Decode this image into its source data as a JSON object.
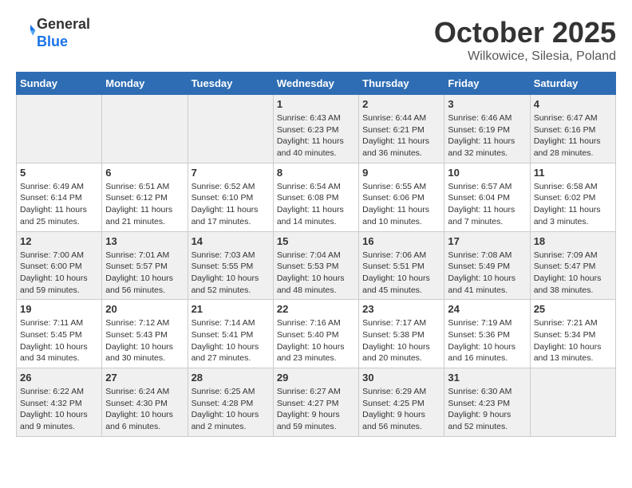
{
  "header": {
    "logo": {
      "general": "General",
      "blue": "Blue"
    },
    "title": "October 2025",
    "location": "Wilkowice, Silesia, Poland"
  },
  "days_of_week": [
    "Sunday",
    "Monday",
    "Tuesday",
    "Wednesday",
    "Thursday",
    "Friday",
    "Saturday"
  ],
  "weeks": [
    [
      {
        "day": "",
        "info": ""
      },
      {
        "day": "",
        "info": ""
      },
      {
        "day": "",
        "info": ""
      },
      {
        "day": "1",
        "info": "Sunrise: 6:43 AM\nSunset: 6:23 PM\nDaylight: 11 hours\nand 40 minutes."
      },
      {
        "day": "2",
        "info": "Sunrise: 6:44 AM\nSunset: 6:21 PM\nDaylight: 11 hours\nand 36 minutes."
      },
      {
        "day": "3",
        "info": "Sunrise: 6:46 AM\nSunset: 6:19 PM\nDaylight: 11 hours\nand 32 minutes."
      },
      {
        "day": "4",
        "info": "Sunrise: 6:47 AM\nSunset: 6:16 PM\nDaylight: 11 hours\nand 28 minutes."
      }
    ],
    [
      {
        "day": "5",
        "info": "Sunrise: 6:49 AM\nSunset: 6:14 PM\nDaylight: 11 hours\nand 25 minutes."
      },
      {
        "day": "6",
        "info": "Sunrise: 6:51 AM\nSunset: 6:12 PM\nDaylight: 11 hours\nand 21 minutes."
      },
      {
        "day": "7",
        "info": "Sunrise: 6:52 AM\nSunset: 6:10 PM\nDaylight: 11 hours\nand 17 minutes."
      },
      {
        "day": "8",
        "info": "Sunrise: 6:54 AM\nSunset: 6:08 PM\nDaylight: 11 hours\nand 14 minutes."
      },
      {
        "day": "9",
        "info": "Sunrise: 6:55 AM\nSunset: 6:06 PM\nDaylight: 11 hours\nand 10 minutes."
      },
      {
        "day": "10",
        "info": "Sunrise: 6:57 AM\nSunset: 6:04 PM\nDaylight: 11 hours\nand 7 minutes."
      },
      {
        "day": "11",
        "info": "Sunrise: 6:58 AM\nSunset: 6:02 PM\nDaylight: 11 hours\nand 3 minutes."
      }
    ],
    [
      {
        "day": "12",
        "info": "Sunrise: 7:00 AM\nSunset: 6:00 PM\nDaylight: 10 hours\nand 59 minutes."
      },
      {
        "day": "13",
        "info": "Sunrise: 7:01 AM\nSunset: 5:57 PM\nDaylight: 10 hours\nand 56 minutes."
      },
      {
        "day": "14",
        "info": "Sunrise: 7:03 AM\nSunset: 5:55 PM\nDaylight: 10 hours\nand 52 minutes."
      },
      {
        "day": "15",
        "info": "Sunrise: 7:04 AM\nSunset: 5:53 PM\nDaylight: 10 hours\nand 48 minutes."
      },
      {
        "day": "16",
        "info": "Sunrise: 7:06 AM\nSunset: 5:51 PM\nDaylight: 10 hours\nand 45 minutes."
      },
      {
        "day": "17",
        "info": "Sunrise: 7:08 AM\nSunset: 5:49 PM\nDaylight: 10 hours\nand 41 minutes."
      },
      {
        "day": "18",
        "info": "Sunrise: 7:09 AM\nSunset: 5:47 PM\nDaylight: 10 hours\nand 38 minutes."
      }
    ],
    [
      {
        "day": "19",
        "info": "Sunrise: 7:11 AM\nSunset: 5:45 PM\nDaylight: 10 hours\nand 34 minutes."
      },
      {
        "day": "20",
        "info": "Sunrise: 7:12 AM\nSunset: 5:43 PM\nDaylight: 10 hours\nand 30 minutes."
      },
      {
        "day": "21",
        "info": "Sunrise: 7:14 AM\nSunset: 5:41 PM\nDaylight: 10 hours\nand 27 minutes."
      },
      {
        "day": "22",
        "info": "Sunrise: 7:16 AM\nSunset: 5:40 PM\nDaylight: 10 hours\nand 23 minutes."
      },
      {
        "day": "23",
        "info": "Sunrise: 7:17 AM\nSunset: 5:38 PM\nDaylight: 10 hours\nand 20 minutes."
      },
      {
        "day": "24",
        "info": "Sunrise: 7:19 AM\nSunset: 5:36 PM\nDaylight: 10 hours\nand 16 minutes."
      },
      {
        "day": "25",
        "info": "Sunrise: 7:21 AM\nSunset: 5:34 PM\nDaylight: 10 hours\nand 13 minutes."
      }
    ],
    [
      {
        "day": "26",
        "info": "Sunrise: 6:22 AM\nSunset: 4:32 PM\nDaylight: 10 hours\nand 9 minutes."
      },
      {
        "day": "27",
        "info": "Sunrise: 6:24 AM\nSunset: 4:30 PM\nDaylight: 10 hours\nand 6 minutes."
      },
      {
        "day": "28",
        "info": "Sunrise: 6:25 AM\nSunset: 4:28 PM\nDaylight: 10 hours\nand 2 minutes."
      },
      {
        "day": "29",
        "info": "Sunrise: 6:27 AM\nSunset: 4:27 PM\nDaylight: 9 hours\nand 59 minutes."
      },
      {
        "day": "30",
        "info": "Sunrise: 6:29 AM\nSunset: 4:25 PM\nDaylight: 9 hours\nand 56 minutes."
      },
      {
        "day": "31",
        "info": "Sunrise: 6:30 AM\nSunset: 4:23 PM\nDaylight: 9 hours\nand 52 minutes."
      },
      {
        "day": "",
        "info": ""
      }
    ]
  ]
}
